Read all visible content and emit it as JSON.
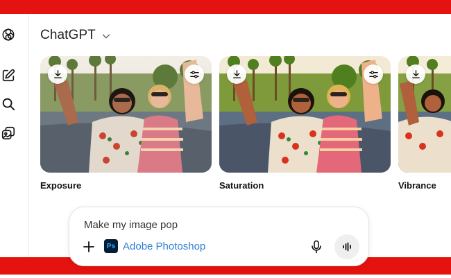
{
  "app": {
    "title": "ChatGPT",
    "accent_red": "#e4130f"
  },
  "sidebar": {
    "items": [
      {
        "icon": "openai-logo-icon"
      },
      {
        "icon": "new-chat-icon"
      },
      {
        "icon": "search-icon"
      },
      {
        "icon": "images-icon"
      }
    ]
  },
  "cards": [
    {
      "label": "Exposure",
      "tone": "neutral"
    },
    {
      "label": "Saturation",
      "tone": "saturated"
    },
    {
      "label": "Vibrance",
      "tone": "vibrant"
    }
  ],
  "card_buttons": {
    "download_icon": "download-icon",
    "adjust_icon": "sliders-icon"
  },
  "composer": {
    "prompt": "Make my image pop",
    "app_chip_logo": "Ps",
    "app_chip_name": "Adobe Photoshop",
    "app_chip_color": "#2d7fd3"
  }
}
